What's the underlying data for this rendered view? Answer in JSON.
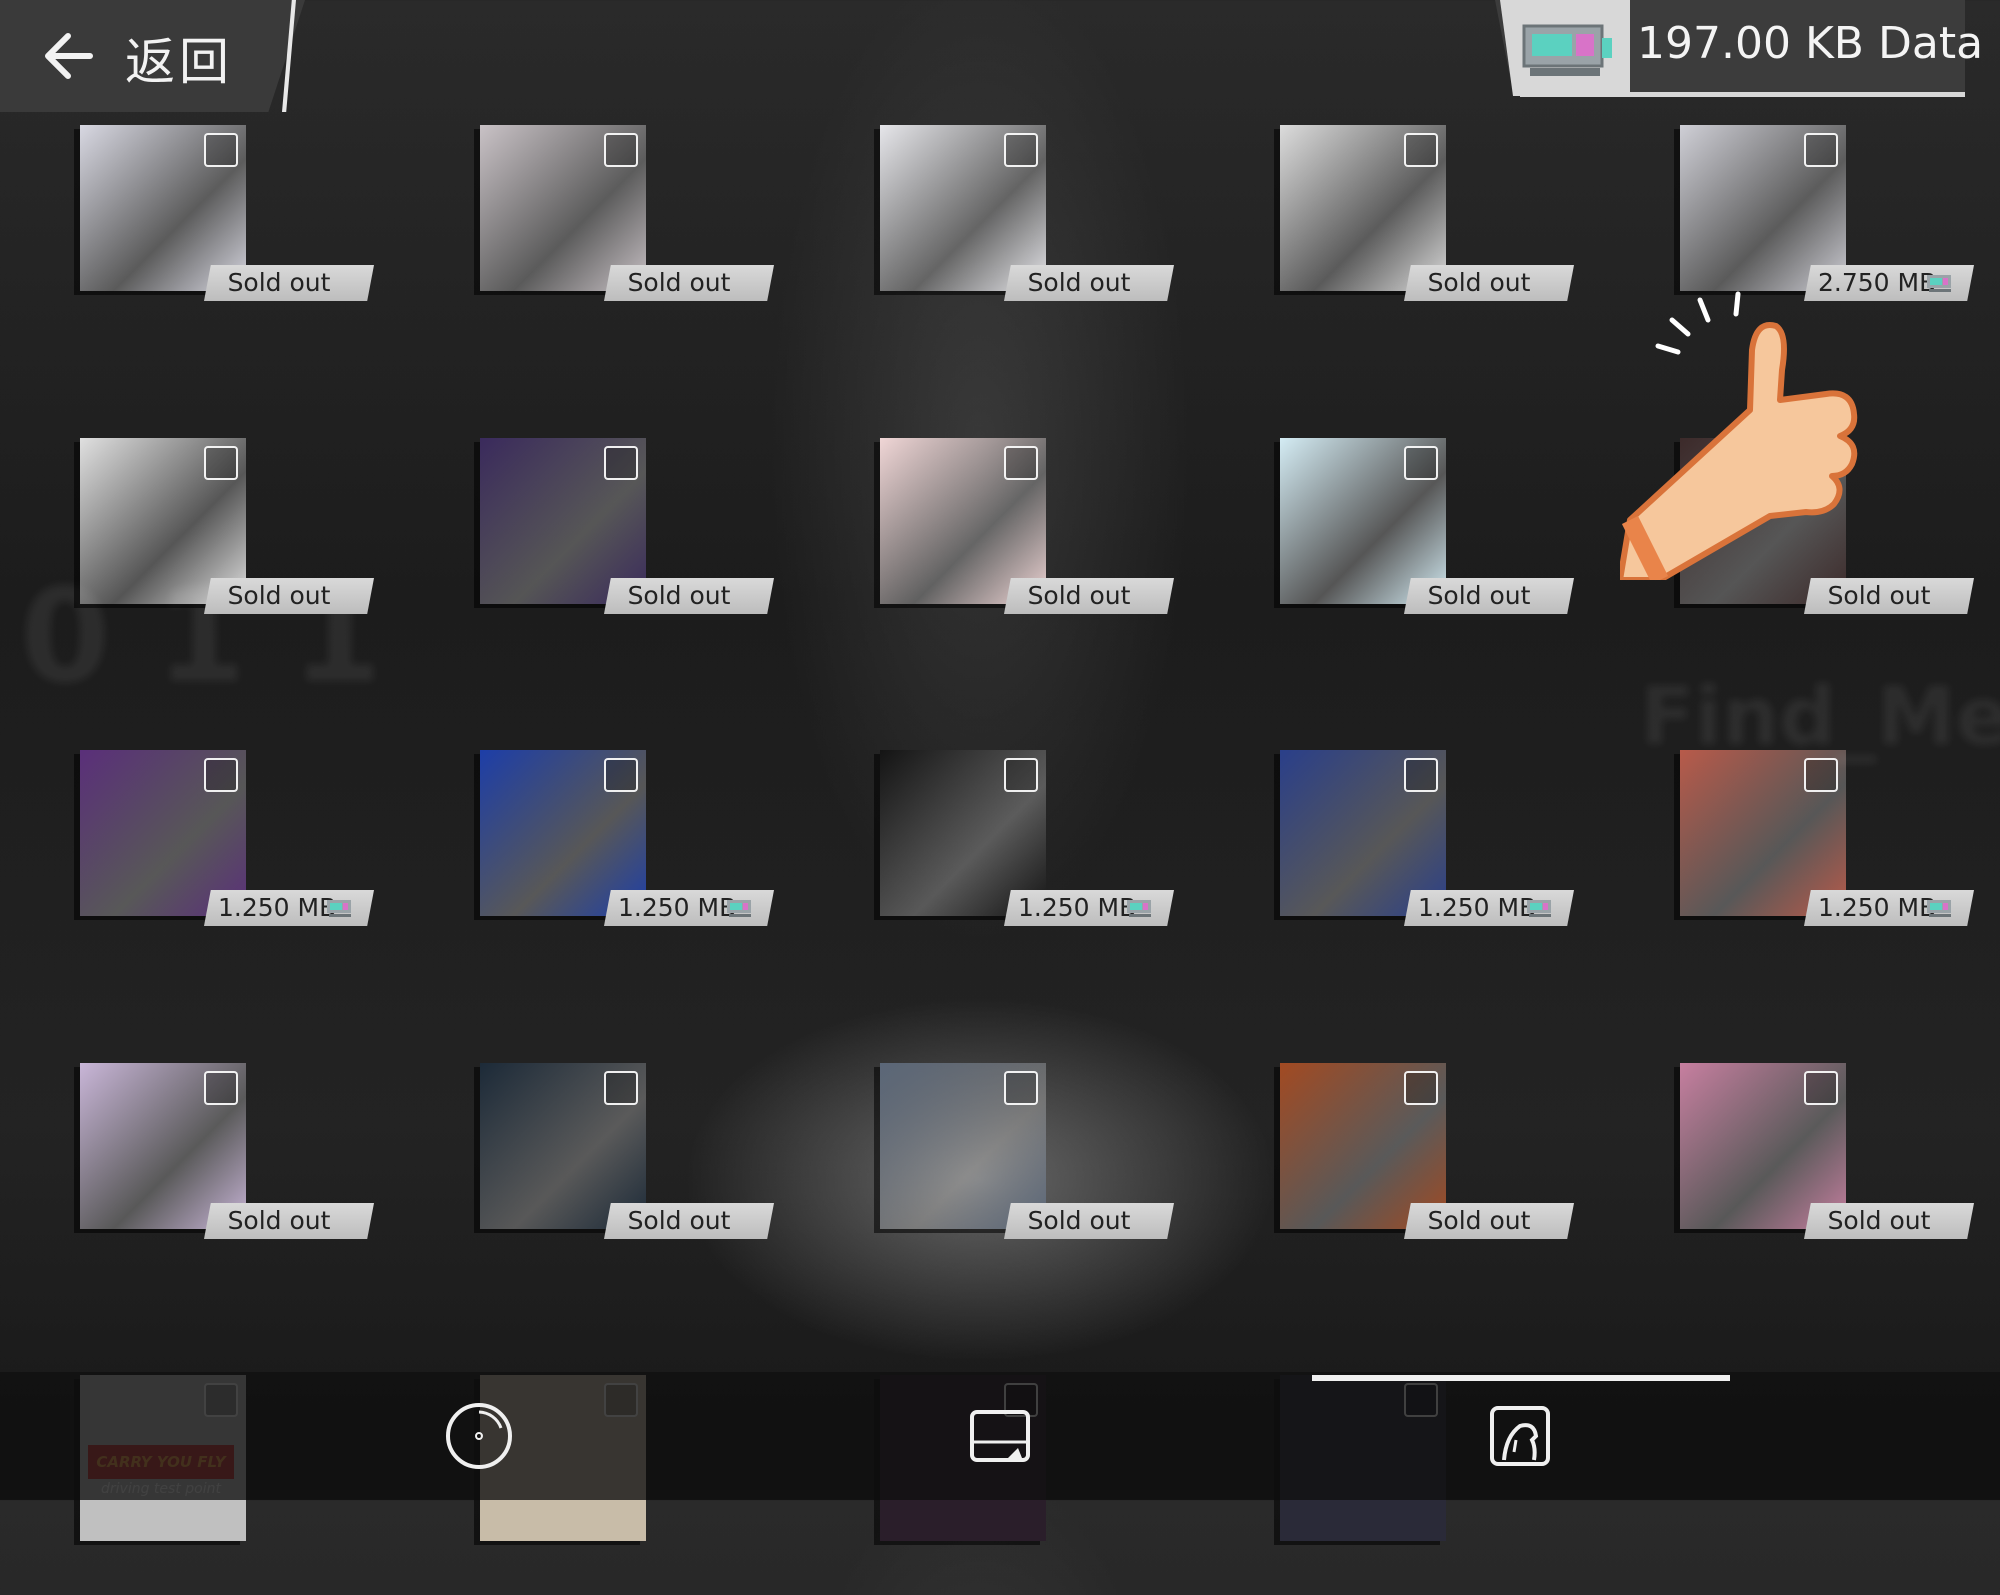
{
  "header": {
    "back_label": "返回",
    "data_amount": "197.00 KB Data"
  },
  "colors": {
    "panel": "#3a3a3a",
    "badge": "#cfcfcf",
    "badge_text": "#222222",
    "accent_chip": "#5bd1c0",
    "chip_pink": "#d873c8"
  },
  "grid": {
    "items": [
      {
        "status": "Sold out",
        "type": "sold",
        "art": "#d8d8e2"
      },
      {
        "status": "Sold out",
        "type": "sold",
        "art": "#c9c2c6"
      },
      {
        "status": "Sold out",
        "type": "sold",
        "art": "#e6e6ea"
      },
      {
        "status": "Sold out",
        "type": "sold",
        "art": "#dcdcdc"
      },
      {
        "status": "2.750 MB",
        "type": "price",
        "art": "#cfcfd6"
      },
      {
        "status": "Sold out",
        "type": "sold",
        "art": "#e0e0e0"
      },
      {
        "status": "Sold out",
        "type": "sold",
        "art": "#3a2a5c"
      },
      {
        "status": "Sold out",
        "type": "sold",
        "art": "#f0d6d6"
      },
      {
        "status": "Sold out",
        "type": "sold",
        "art": "#d4ecf4"
      },
      {
        "status": "Sold out",
        "type": "sold",
        "art": "#3c2a2a"
      },
      {
        "status": "1.250 MB",
        "type": "price",
        "art": "#5a2f7a"
      },
      {
        "status": "1.250 MB",
        "type": "price",
        "art": "#1d3ea8"
      },
      {
        "status": "1.250 MB",
        "type": "price",
        "art": "#141414"
      },
      {
        "status": "1.250 MB",
        "type": "price",
        "art": "#2a3f8a"
      },
      {
        "status": "1.250 MB",
        "type": "price",
        "art": "#b85a4a"
      },
      {
        "status": "Sold out",
        "type": "sold",
        "art": "#c9b6d8"
      },
      {
        "status": "Sold out",
        "type": "sold",
        "art": "#1c2a38"
      },
      {
        "status": "Sold out",
        "type": "sold",
        "art": "#5b6778"
      },
      {
        "status": "Sold out",
        "type": "sold",
        "art": "#a24a22"
      },
      {
        "status": "Sold out",
        "type": "sold",
        "art": "#c77fa0"
      }
    ],
    "partial_row": [
      {
        "art": "#c0c0c0",
        "caption": "CARRY YOU FLY",
        "subcaption": "driving test point"
      },
      {
        "art": "#c8bca8"
      },
      {
        "art": "#2a1e2a"
      },
      {
        "art": "#2a2a38"
      }
    ]
  },
  "bottom_nav": {
    "items": [
      {
        "icon": "disc-icon"
      },
      {
        "icon": "image-icon"
      },
      {
        "icon": "avatar-icon"
      }
    ]
  }
}
